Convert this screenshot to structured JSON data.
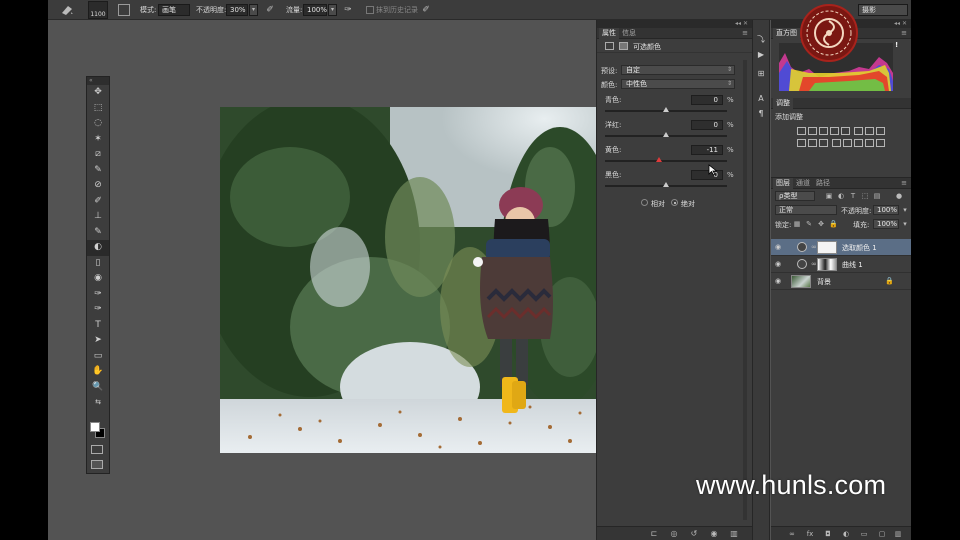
{
  "options_bar": {
    "brush_size": "1100",
    "mode_label": "模式:",
    "mode_value": "画笔",
    "opacity_label": "不透明度:",
    "opacity_value": "30%",
    "flow_label": "流量:",
    "flow_value": "100%",
    "history_label": "抹到历史记录",
    "workspace_value": "摄影"
  },
  "tools": {
    "header": "«",
    "glyphs": [
      "✥",
      "⬚",
      "◌",
      "✶",
      "⧄",
      "✎",
      "⊘",
      "✐",
      "⊥",
      "✎",
      "◐",
      "▯",
      "◉",
      "✑",
      "T",
      "➤",
      "▭",
      "✋",
      "🔍",
      "⇆"
    ]
  },
  "properties": {
    "tabs": [
      "属性",
      "信息"
    ],
    "title": "可选颜色",
    "preset_label": "预设:",
    "preset_value": "自定",
    "colors_label": "颜色:",
    "colors_value": "中性色",
    "sliders": [
      {
        "label": "青色:",
        "value": "0",
        "unit": "%",
        "position": 0.5
      },
      {
        "label": "洋红:",
        "value": "0",
        "unit": "%",
        "position": 0.5
      },
      {
        "label": "黄色:",
        "value": "-11",
        "unit": "%",
        "position": 0.445
      },
      {
        "label": "黑色:",
        "value": "0",
        "unit": "%",
        "position": 0.5
      }
    ],
    "method_relative": "相对",
    "method_absolute": "绝对",
    "method_selected": "absolute"
  },
  "histogram": {
    "tab": "直方图",
    "warning": "!"
  },
  "adjustments": {
    "tab": "调整",
    "title": "添加调整"
  },
  "layers": {
    "tabs": [
      "图层",
      "通道",
      "路径"
    ],
    "kind_filter": "ρ类型",
    "blend_mode": "正常",
    "opacity_label": "不透明度:",
    "opacity_value": "100%",
    "lock_label": "锁定:",
    "fill_label": "填充:",
    "fill_value": "100%",
    "items": [
      {
        "name": "选取颜色 1",
        "selected": true
      },
      {
        "name": "曲线 1",
        "selected": false
      },
      {
        "name": "背景",
        "selected": false
      }
    ]
  },
  "watermark": "www.hunls.com"
}
